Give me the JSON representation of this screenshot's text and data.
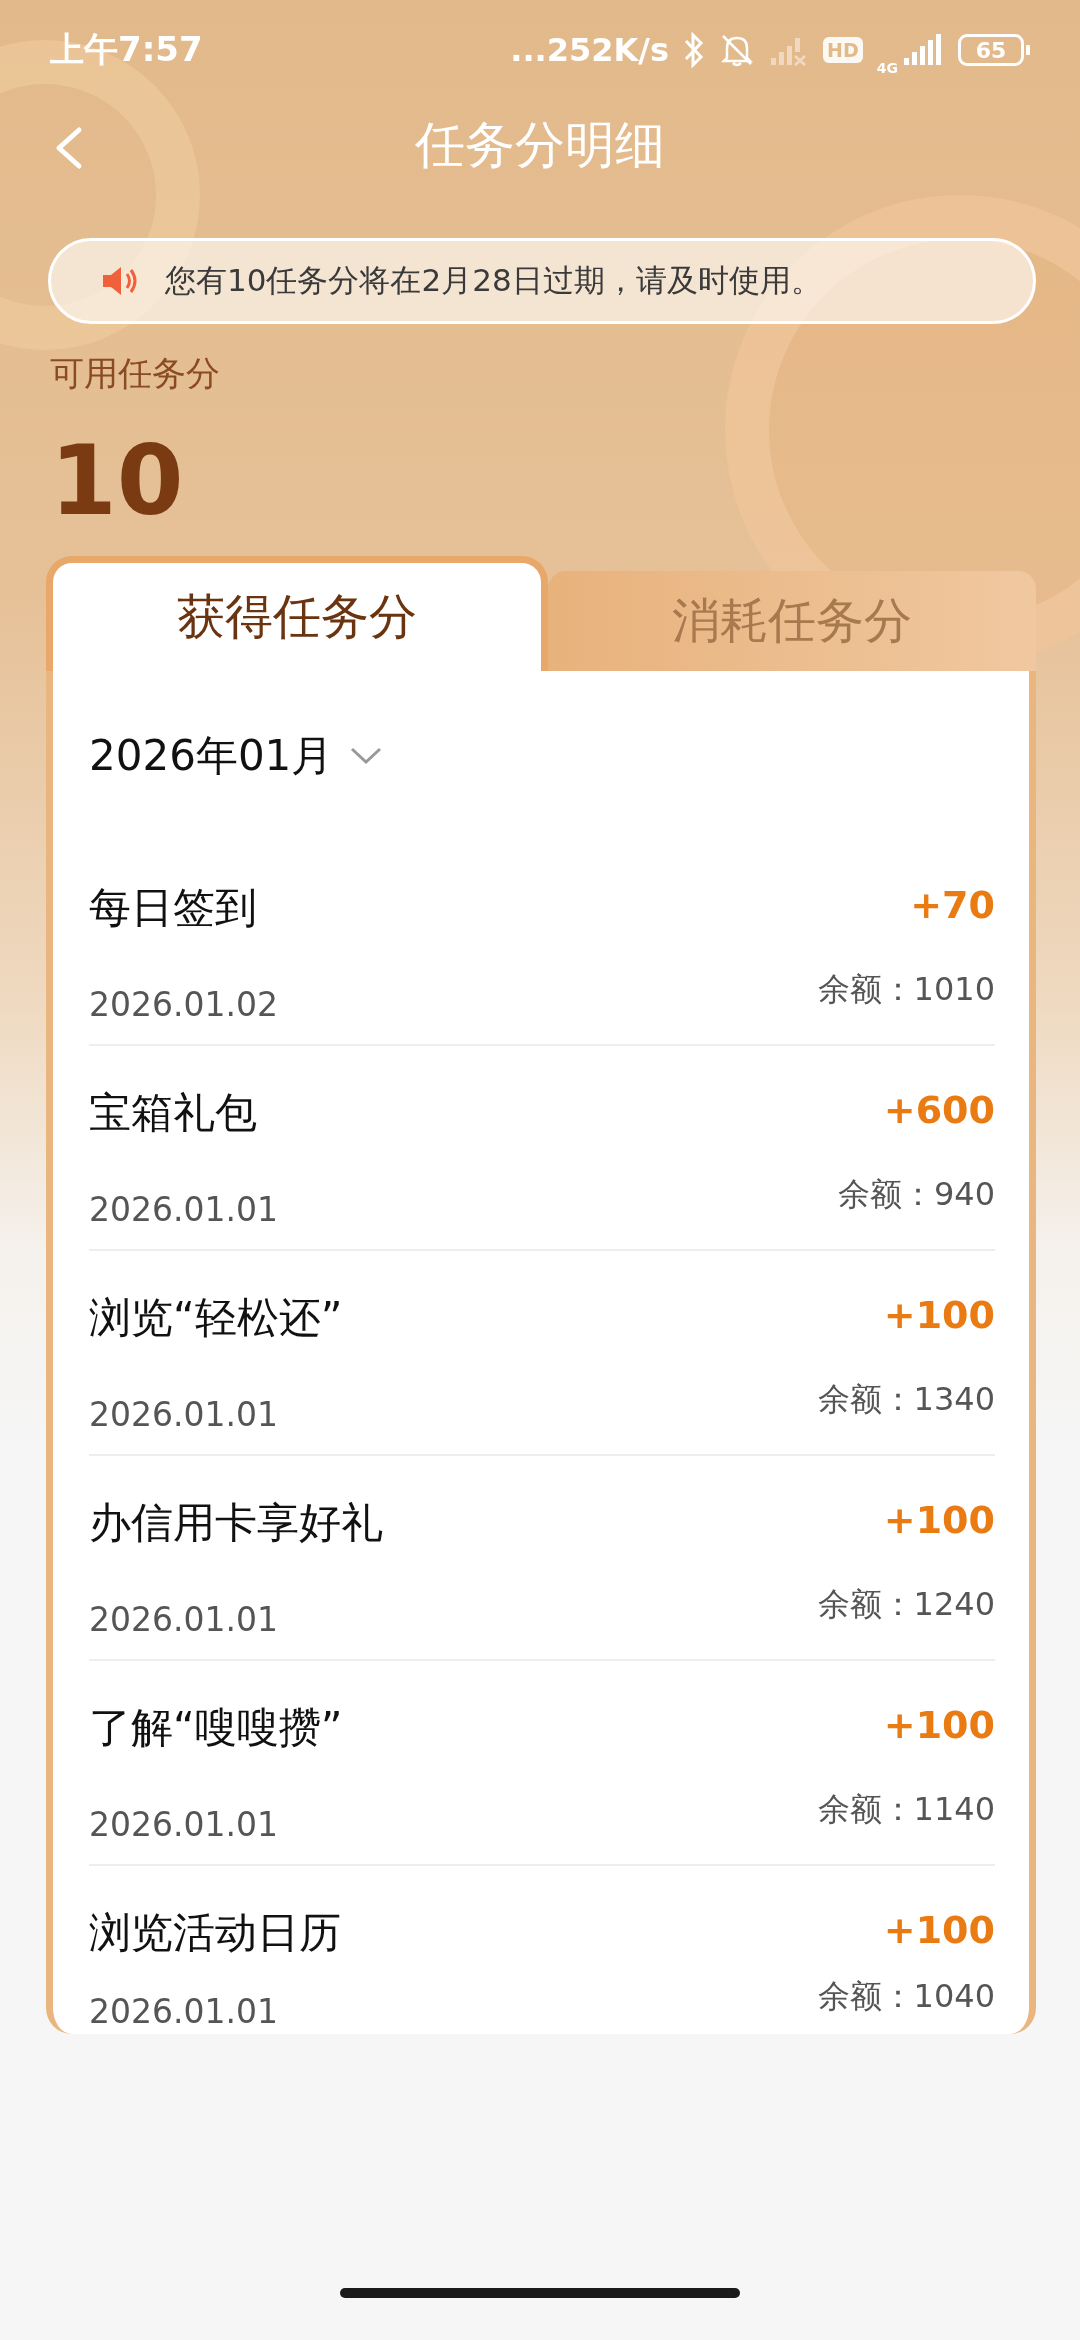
{
  "status_bar": {
    "time": "上午7:57",
    "net_speed": "...252K/s",
    "hd_badge": "HD",
    "network_type": "4G",
    "battery": "65"
  },
  "header": {
    "title": "任务分明细"
  },
  "notice": {
    "text": "您有10任务分将在2月28日过期，请及时使用。"
  },
  "summary": {
    "label": "可用任务分",
    "value": "10"
  },
  "tabs": [
    {
      "label": "获得任务分",
      "selected": true
    },
    {
      "label": "消耗任务分",
      "selected": false
    }
  ],
  "month_picker": {
    "value": "2026年01月"
  },
  "records": [
    {
      "title": "每日签到",
      "date": "2026.01.02",
      "points": "+70",
      "balance": "余额：1010"
    },
    {
      "title": "宝箱礼包",
      "date": "2026.01.01",
      "points": "+600",
      "balance": "余额：940"
    },
    {
      "title": "浏览“轻松还”",
      "date": "2026.01.01",
      "points": "+100",
      "balance": "余额：1340"
    },
    {
      "title": "办信用卡享好礼",
      "date": "2026.01.01",
      "points": "+100",
      "balance": "余额：1240"
    },
    {
      "title": "了解“嗖嗖攒”",
      "date": "2026.01.01",
      "points": "+100",
      "balance": "余额：1140"
    },
    {
      "title": "浏览活动日历",
      "date": "2026.01.01",
      "points": "+100",
      "balance": "余额：1040"
    }
  ]
}
